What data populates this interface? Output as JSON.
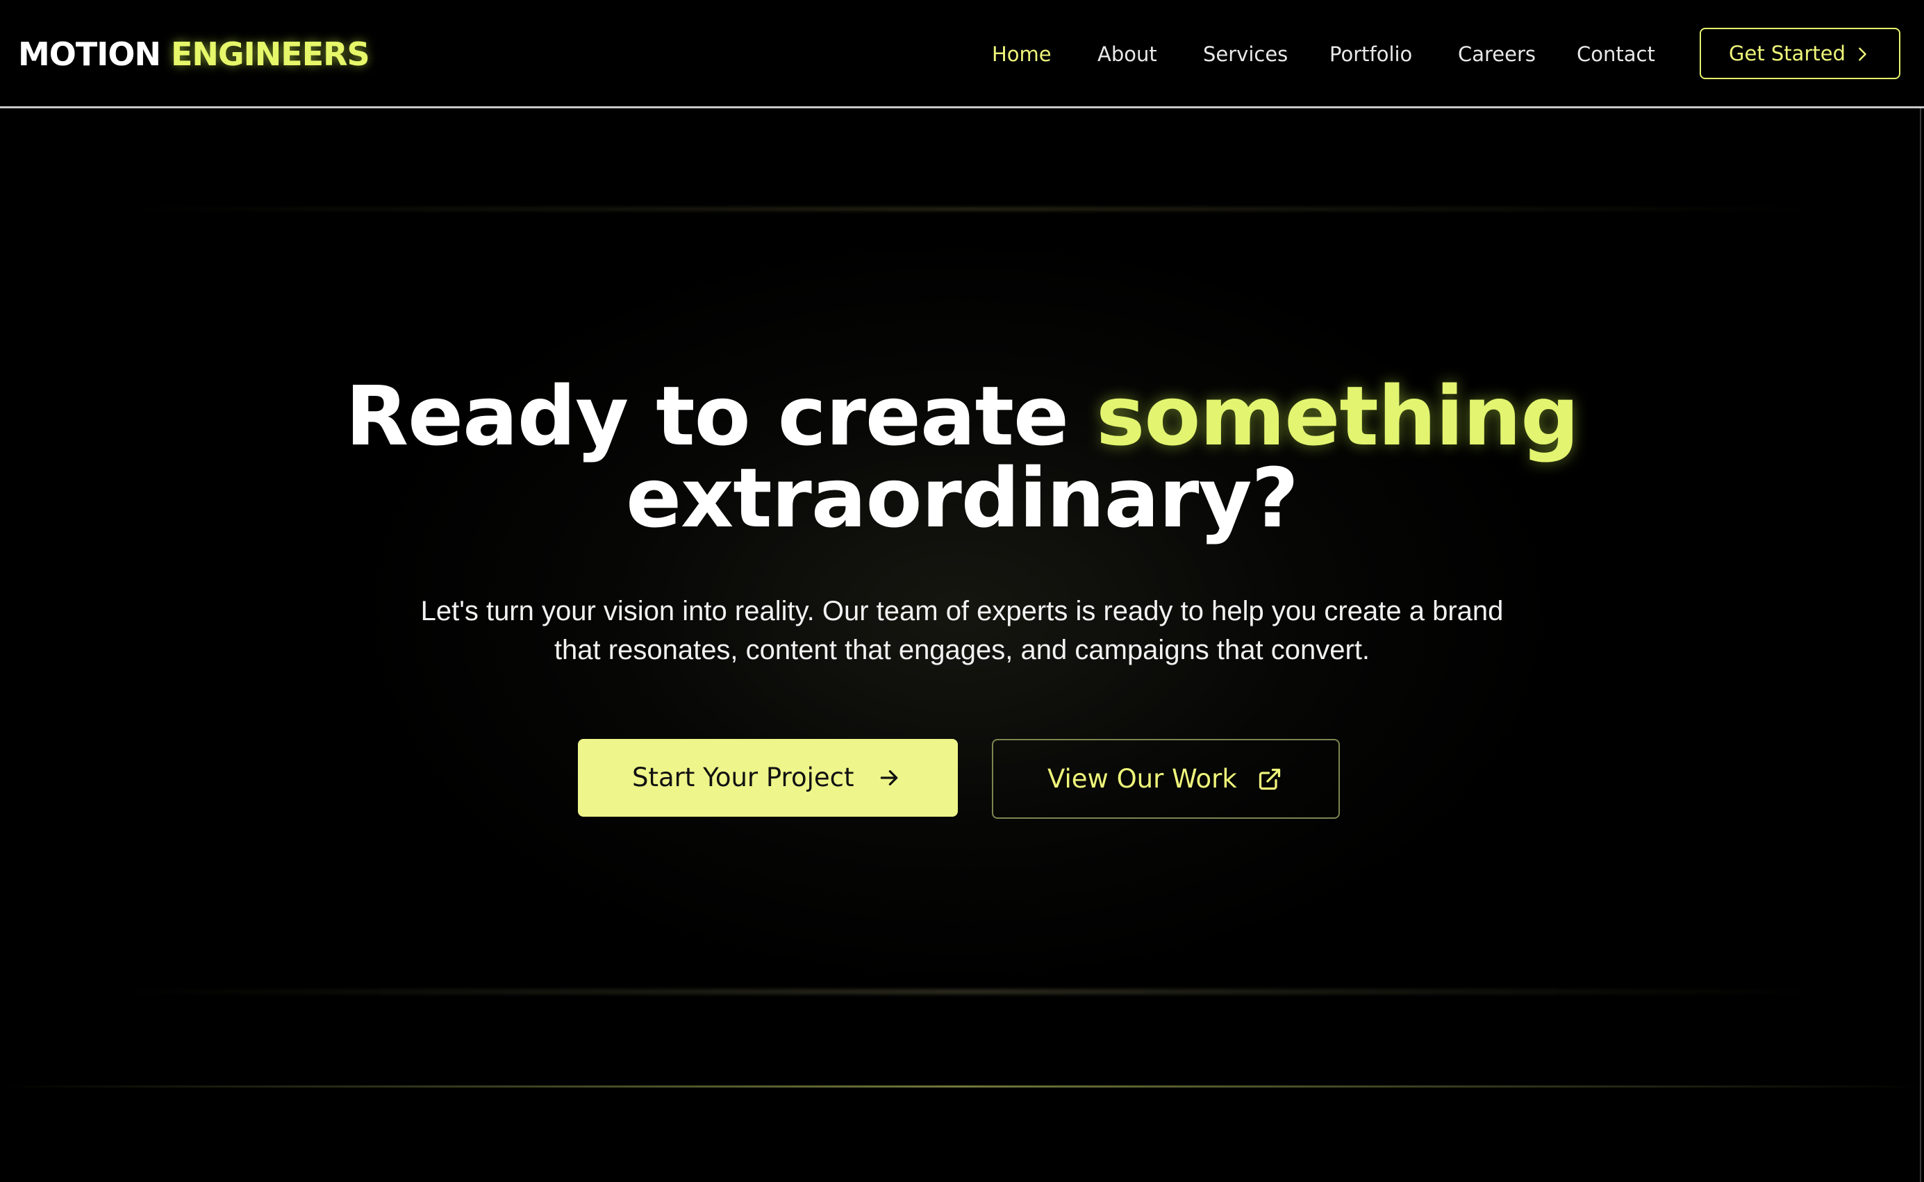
{
  "brand": {
    "name_part1": "MOTION",
    "name_part2": "ENGINEERS"
  },
  "nav": {
    "items": [
      {
        "label": "Home",
        "active": true
      },
      {
        "label": "About",
        "active": false
      },
      {
        "label": "Services",
        "active": false
      },
      {
        "label": "Portfolio",
        "active": false
      },
      {
        "label": "Careers",
        "active": false
      },
      {
        "label": "Contact",
        "active": false
      }
    ],
    "cta_label": "Get Started",
    "cta_icon": "chevron-right-icon"
  },
  "hero": {
    "headline_part1": "Ready to create",
    "headline_highlight": "something",
    "headline_part2": "extraordinary?",
    "subtitle": "Let's turn your vision into reality. Our team of experts is ready to help you create a brand that resonates, content that engages, and campaigns that convert.",
    "primary_button": {
      "label": "Start Your Project",
      "icon": "arrow-right-icon"
    },
    "secondary_button": {
      "label": "View Our Work",
      "icon": "external-link-icon"
    }
  },
  "colors": {
    "accent": "#e6f76a",
    "background": "#000000",
    "primary_button_bg": "#eef58a",
    "text": "#ffffff"
  }
}
